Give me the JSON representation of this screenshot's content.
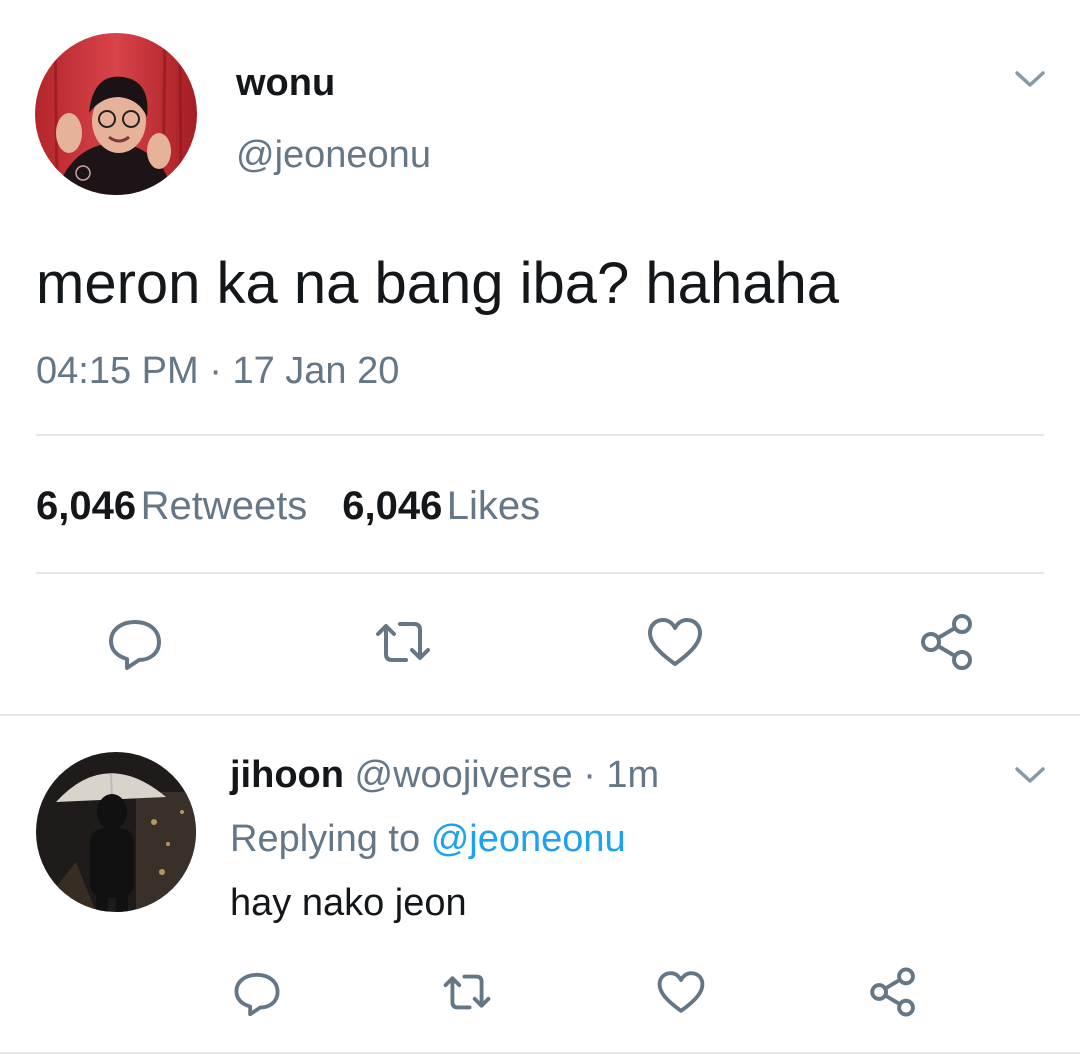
{
  "tweet": {
    "author_name": "wonu",
    "author_handle": "@jeoneonu",
    "text": "meron ka na bang iba? hahaha",
    "time": "04:15 PM",
    "separator": "·",
    "date": "17 Jan 20",
    "retweets_count": "6,046",
    "retweets_label": "Retweets",
    "likes_count": "6,046",
    "likes_label": "Likes"
  },
  "reply": {
    "author_name": "jihoon",
    "author_handle": "@woojiverse",
    "separator": "·",
    "age": "1m",
    "replying_prefix": "Replying to",
    "replying_handle": "@jeoneonu",
    "text": "hay nako jeon"
  },
  "colors": {
    "text_primary": "#14171a",
    "text_secondary": "#657786",
    "link_blue": "#1da1f2",
    "divider": "#e1e8ed"
  },
  "icons": {
    "caret": "chevron-down-icon",
    "reply": "reply-icon",
    "retweet": "retweet-icon",
    "like": "heart-icon",
    "share": "share-icon"
  }
}
